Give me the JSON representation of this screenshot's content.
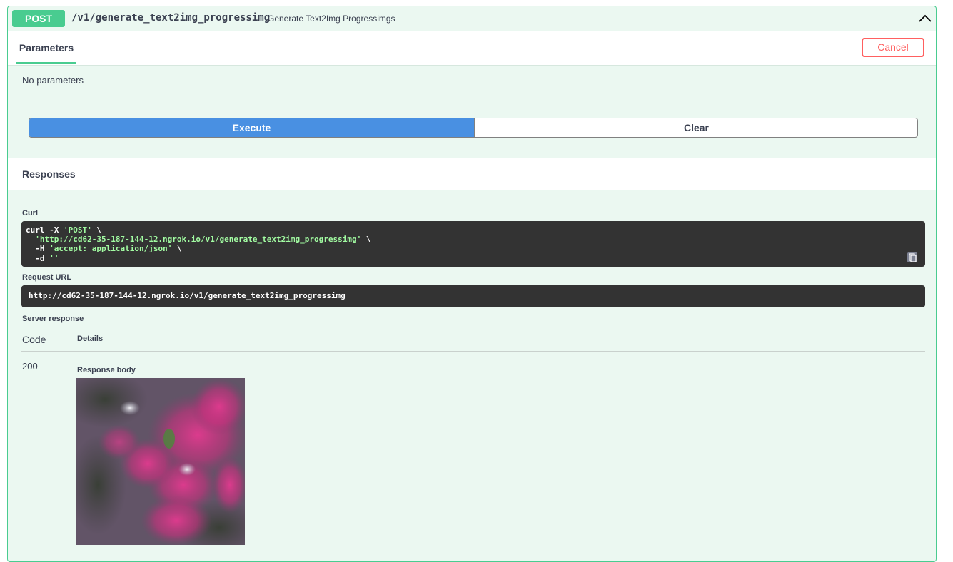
{
  "operation": {
    "method": "POST",
    "path": "/v1/generate_text2img_progressimg",
    "description": "Generate Text2Img Progressimgs"
  },
  "parameters": {
    "tab_label": "Parameters",
    "cancel_label": "Cancel",
    "empty_text": "No parameters"
  },
  "actions": {
    "execute_label": "Execute",
    "clear_label": "Clear"
  },
  "responses": {
    "title": "Responses",
    "curl_label": "Curl",
    "curl_line1_cmd": "curl -X ",
    "curl_line1_method": "'POST'",
    "curl_line1_tail": " \\",
    "curl_line2_url": "'http://cd62-35-187-144-12.ngrok.io/v1/generate_text2img_progressimg'",
    "curl_line2_tail": " \\",
    "curl_line3_flag": "  -H ",
    "curl_line3_value": "'accept: application/json'",
    "curl_line3_tail": " \\",
    "curl_line4_flag": "  -d ",
    "curl_line4_value": "''",
    "request_url_label": "Request URL",
    "request_url": "http://cd62-35-187-144-12.ngrok.io/v1/generate_text2img_progressimg",
    "server_response_label": "Server response",
    "table_code_header": "Code",
    "table_details_header": "Details",
    "status_code": "200",
    "response_body_label": "Response body"
  },
  "colors": {
    "post_green": "#49cc90",
    "execute_blue": "#4990e2",
    "cancel_red": "#ff6060",
    "code_bg": "#333333"
  },
  "icons": [
    "chevron-up-icon",
    "copy-to-clipboard-icon"
  ]
}
